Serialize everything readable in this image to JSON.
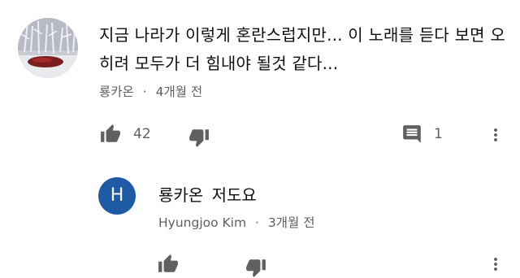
{
  "comments": [
    {
      "text": "지금 나라가 이렇게 혼란스럽지만... 이 노래를 듣다 보면 오히려 모두가 더 힘내야 될것 같다...",
      "author": "룡카온",
      "time": "4개월 전",
      "likes": "42",
      "replies": "1"
    }
  ],
  "reply": {
    "avatar_letter": "H",
    "mention": "룡카온",
    "text": "저도요",
    "author": "Hyungjoo Kim",
    "time": "3개월 전"
  },
  "separator": "·",
  "colors": {
    "avatar_bg": "#1f5aa6",
    "icon": "#606060",
    "meta_text": "#606060"
  },
  "icons": [
    "thumb-up-icon",
    "thumb-down-icon",
    "reply-icon",
    "more-vert-icon"
  ]
}
